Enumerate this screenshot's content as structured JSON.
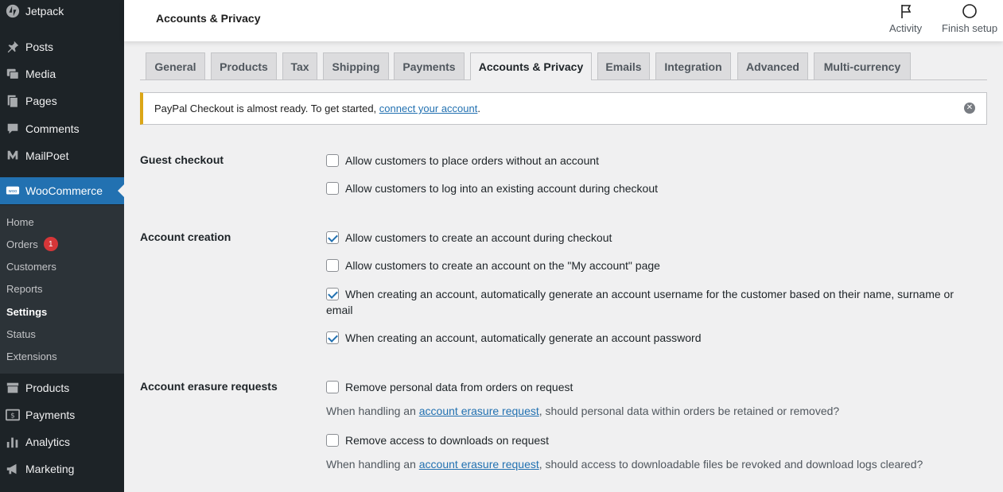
{
  "sidebar": {
    "items": [
      {
        "label": "Jetpack",
        "icon": "jetpack-icon"
      },
      {
        "label": "Posts",
        "icon": "pin-icon"
      },
      {
        "label": "Media",
        "icon": "media-icon"
      },
      {
        "label": "Pages",
        "icon": "pages-icon"
      },
      {
        "label": "Comments",
        "icon": "comment-icon"
      },
      {
        "label": "MailPoet",
        "icon": "mailpoet-icon"
      },
      {
        "label": "WooCommerce",
        "icon": "woo-icon"
      },
      {
        "label": "Products",
        "icon": "archive-icon"
      },
      {
        "label": "Payments",
        "icon": "dollar-icon"
      },
      {
        "label": "Analytics",
        "icon": "bar-chart-icon"
      },
      {
        "label": "Marketing",
        "icon": "megaphone-icon"
      }
    ],
    "submenu": [
      {
        "label": "Home"
      },
      {
        "label": "Orders",
        "badge": "1"
      },
      {
        "label": "Customers"
      },
      {
        "label": "Reports"
      },
      {
        "label": "Settings"
      },
      {
        "label": "Status"
      },
      {
        "label": "Extensions"
      }
    ]
  },
  "header": {
    "title": "Accounts & Privacy",
    "activity_label": "Activity",
    "finish_label": "Finish setup"
  },
  "tabs": [
    {
      "label": "General"
    },
    {
      "label": "Products"
    },
    {
      "label": "Tax"
    },
    {
      "label": "Shipping"
    },
    {
      "label": "Payments"
    },
    {
      "label": "Accounts & Privacy",
      "active": true
    },
    {
      "label": "Emails"
    },
    {
      "label": "Integration"
    },
    {
      "label": "Advanced"
    },
    {
      "label": "Multi-currency"
    }
  ],
  "notice": {
    "text_before": "PayPal Checkout is almost ready. To get started, ",
    "link": "connect your account",
    "text_after": "."
  },
  "sections": {
    "guest": {
      "label": "Guest checkout",
      "opt1": "Allow customers to place orders without an account",
      "opt2": "Allow customers to log into an existing account during checkout"
    },
    "creation": {
      "label": "Account creation",
      "opt1": "Allow customers to create an account during checkout",
      "opt2": "Allow customers to create an account on the \"My account\" page",
      "opt3": "When creating an account, automatically generate an account username for the customer based on their name, surname or email",
      "opt4": "When creating an account, automatically generate an account password"
    },
    "erasure": {
      "label": "Account erasure requests",
      "opt1": "Remove personal data from orders on request",
      "desc1_before": "When handling an ",
      "desc1_link": "account erasure request",
      "desc1_after": ", should personal data within orders be retained or removed?",
      "opt2": "Remove access to downloads on request",
      "desc2_before": "When handling an ",
      "desc2_link": "account erasure request",
      "desc2_after": ", should access to downloadable files be revoked and download logs cleared?"
    }
  },
  "checkbox_state": {
    "guest_opt1": false,
    "guest_opt2": false,
    "creation_opt1": true,
    "creation_opt2": false,
    "creation_opt3": true,
    "creation_opt4": true,
    "erasure_opt1": false,
    "erasure_opt2": false
  },
  "colors": {
    "sidebar_bg": "#1d2327",
    "active_blue": "#2271b1",
    "notice_warning": "#dba617",
    "badge_red": "#d63638"
  }
}
